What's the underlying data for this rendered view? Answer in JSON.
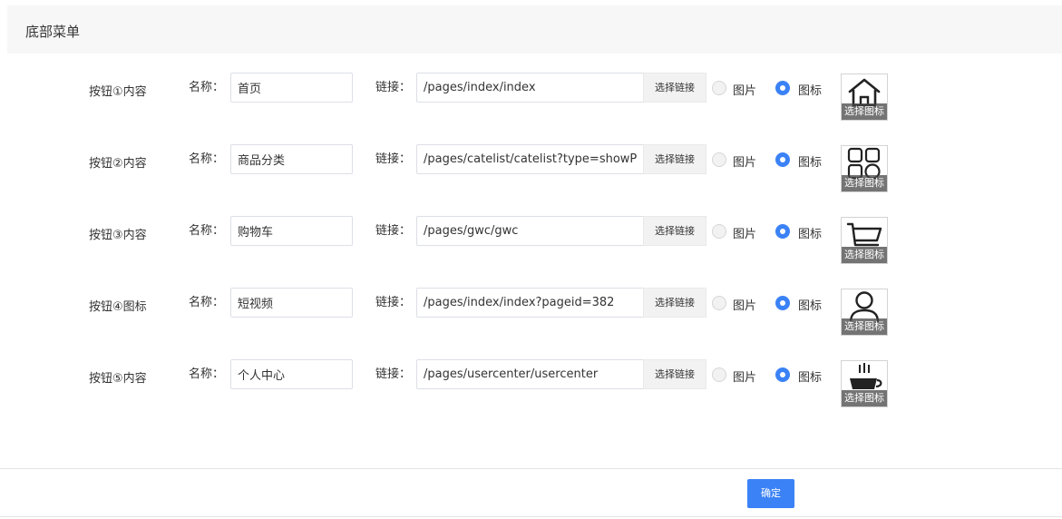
{
  "header": {
    "title": "底部菜单"
  },
  "labels": {
    "name": "名称：",
    "link": "链接：",
    "link_button": "选择链接",
    "radio_picture": "图片",
    "radio_icon": "图标",
    "choose_icon": "选择图标"
  },
  "rows": [
    {
      "label": "按钮①内容",
      "name": "首页",
      "link": "/pages/index/index",
      "selected": "icon",
      "icon": "home-icon"
    },
    {
      "label": "按钮②内容",
      "name": "商品分类",
      "link": "/pages/catelist/catelist?type=showPro",
      "selected": "icon",
      "icon": "category-grid-icon"
    },
    {
      "label": "按钮③内容",
      "name": "购物车",
      "link": "/pages/gwc/gwc",
      "selected": "icon",
      "icon": "cart-icon"
    },
    {
      "label": "按钮④图标",
      "name": "短视频",
      "link": "/pages/index/index?pageid=382",
      "selected": "icon",
      "icon": "user-icon"
    },
    {
      "label": "按钮⑤内容",
      "name": "个人中心",
      "link": "/pages/usercenter/usercenter",
      "selected": "icon",
      "icon": "coffee-cup-icon"
    }
  ],
  "footer": {
    "confirm_label": "确定"
  },
  "colors": {
    "accent": "#3b82f6",
    "header_bg": "#f7f7f7"
  }
}
